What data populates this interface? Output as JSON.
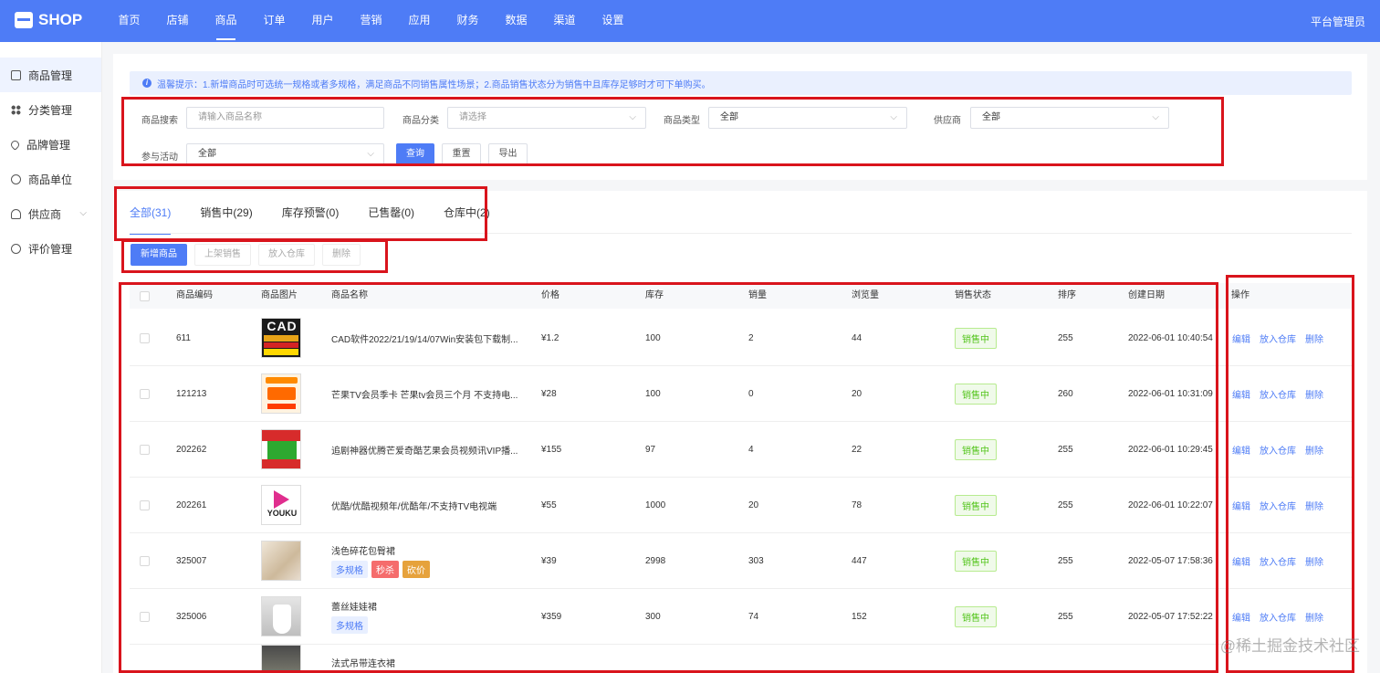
{
  "app": {
    "logo": "SHOP",
    "admin_label": "平台管理员"
  },
  "nav": [
    {
      "label": "首页"
    },
    {
      "label": "店铺"
    },
    {
      "label": "商品",
      "active": true
    },
    {
      "label": "订单"
    },
    {
      "label": "用户"
    },
    {
      "label": "营销"
    },
    {
      "label": "应用"
    },
    {
      "label": "财务"
    },
    {
      "label": "数据"
    },
    {
      "label": "渠道"
    },
    {
      "label": "设置"
    }
  ],
  "sidebar": {
    "items": [
      {
        "label": "商品管理",
        "icon": "box-icon",
        "active": true
      },
      {
        "label": "分类管理",
        "icon": "grid-icon"
      },
      {
        "label": "品牌管理",
        "icon": "heart-icon"
      },
      {
        "label": "商品单位",
        "icon": "target-icon"
      },
      {
        "label": "供应商",
        "icon": "user-icon",
        "expandable": true
      },
      {
        "label": "评价管理",
        "icon": "chat-icon"
      }
    ]
  },
  "tip": "温馨提示：1.新增商品时可选统一规格或者多规格，满足商品不同销售属性场景；2.商品销售状态分为销售中且库存足够时才可下单购买。",
  "filters": {
    "search_label": "商品搜索",
    "search_placeholder": "请输入商品名称",
    "category_label": "商品分类",
    "category_value": "请选择",
    "type_label": "商品类型",
    "type_value": "全部",
    "supplier_label": "供应商",
    "supplier_value": "全部",
    "activity_label": "参与活动",
    "activity_value": "全部",
    "query_btn": "查询",
    "reset_btn": "重置",
    "export_btn": "导出"
  },
  "tabs": [
    {
      "label": "全部(31)",
      "active": true
    },
    {
      "label": "销售中(29)"
    },
    {
      "label": "库存预警(0)"
    },
    {
      "label": "已售罄(0)"
    },
    {
      "label": "仓库中(2)"
    }
  ],
  "actions": {
    "add": "新增商品",
    "on_sale": "上架销售",
    "to_warehouse": "放入仓库",
    "delete": "删除"
  },
  "table": {
    "headers": {
      "code": "商品编码",
      "image": "商品图片",
      "name": "商品名称",
      "price": "价格",
      "stock": "库存",
      "sales": "销量",
      "views": "浏览量",
      "status": "销售状态",
      "sort": "排序",
      "created": "创建日期",
      "ops": "操作"
    },
    "rows": [
      {
        "code": "611",
        "thumb": "cad-icon",
        "name": "CAD软件2022/21/19/14/07Win安装包下载制...",
        "tags": [],
        "price": "¥1.2",
        "stock": "100",
        "sales": "2",
        "views": "44",
        "status": "销售中",
        "sort": "255",
        "created": "2022-06-01 10:40:54"
      },
      {
        "code": "121213",
        "thumb": "mango-tv-icon",
        "name": "芒果TV会员季卡 芒果tv会员三个月 不支持电...",
        "tags": [],
        "price": "¥28",
        "stock": "100",
        "sales": "0",
        "views": "20",
        "status": "销售中",
        "sort": "260",
        "created": "2022-06-01 10:31:09"
      },
      {
        "code": "202262",
        "thumb": "iqiyi-icon",
        "name": "追剧神器优腾芒爱奇酷艺果会员视频讯VIP播...",
        "tags": [],
        "price": "¥155",
        "stock": "97",
        "sales": "4",
        "views": "22",
        "status": "销售中",
        "sort": "255",
        "created": "2022-06-01 10:29:45"
      },
      {
        "code": "202261",
        "thumb": "youku-icon",
        "name": "优酷/优酷视频年/优酷年/不支持TV电视端",
        "tags": [],
        "price": "¥55",
        "stock": "1000",
        "sales": "20",
        "views": "78",
        "status": "销售中",
        "sort": "255",
        "created": "2022-06-01 10:22:07"
      },
      {
        "code": "325007",
        "thumb": "dress-photo",
        "name": "浅色碎花包臀裙",
        "tags": [
          {
            "label": "多规格",
            "kind": "blue"
          },
          {
            "label": "秒杀",
            "kind": "red"
          },
          {
            "label": "砍价",
            "kind": "orange"
          }
        ],
        "price": "¥39",
        "stock": "2998",
        "sales": "303",
        "views": "447",
        "status": "销售中",
        "sort": "255",
        "created": "2022-05-07 17:58:36"
      },
      {
        "code": "325006",
        "thumb": "dress-white-photo",
        "name": "蕾丝娃娃裙",
        "tags": [
          {
            "label": "多规格",
            "kind": "blue"
          }
        ],
        "price": "¥359",
        "stock": "300",
        "sales": "74",
        "views": "152",
        "status": "销售中",
        "sort": "255",
        "created": "2022-05-07 17:52:22"
      },
      {
        "code": "",
        "thumb": "dress-dark-photo",
        "name": "法式吊带连衣裙",
        "tags": [],
        "price": "",
        "stock": "",
        "sales": "",
        "views": "",
        "status": "",
        "sort": "",
        "created": ""
      }
    ],
    "ops": {
      "edit": "编辑",
      "warehouse": "放入仓库",
      "delete": "删除"
    }
  },
  "watermark": "@稀土掘金技术社区",
  "colors": {
    "primary": "#4e7cf6",
    "annotation": "#d9141c",
    "status_green": "#52c41a"
  }
}
